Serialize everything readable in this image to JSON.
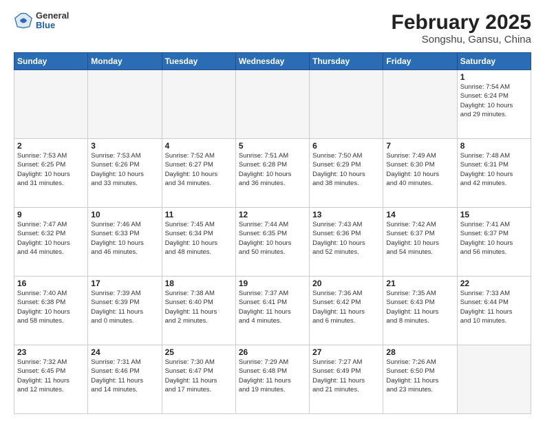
{
  "header": {
    "logo": {
      "general": "General",
      "blue": "Blue"
    },
    "title": "February 2025",
    "subtitle": "Songshu, Gansu, China"
  },
  "weekdays": [
    "Sunday",
    "Monday",
    "Tuesday",
    "Wednesday",
    "Thursday",
    "Friday",
    "Saturday"
  ],
  "weeks": [
    [
      {
        "day": null,
        "info": null
      },
      {
        "day": null,
        "info": null
      },
      {
        "day": null,
        "info": null
      },
      {
        "day": null,
        "info": null
      },
      {
        "day": null,
        "info": null
      },
      {
        "day": null,
        "info": null
      },
      {
        "day": "1",
        "info": "Sunrise: 7:54 AM\nSunset: 6:24 PM\nDaylight: 10 hours\nand 29 minutes."
      }
    ],
    [
      {
        "day": "2",
        "info": "Sunrise: 7:53 AM\nSunset: 6:25 PM\nDaylight: 10 hours\nand 31 minutes."
      },
      {
        "day": "3",
        "info": "Sunrise: 7:53 AM\nSunset: 6:26 PM\nDaylight: 10 hours\nand 33 minutes."
      },
      {
        "day": "4",
        "info": "Sunrise: 7:52 AM\nSunset: 6:27 PM\nDaylight: 10 hours\nand 34 minutes."
      },
      {
        "day": "5",
        "info": "Sunrise: 7:51 AM\nSunset: 6:28 PM\nDaylight: 10 hours\nand 36 minutes."
      },
      {
        "day": "6",
        "info": "Sunrise: 7:50 AM\nSunset: 6:29 PM\nDaylight: 10 hours\nand 38 minutes."
      },
      {
        "day": "7",
        "info": "Sunrise: 7:49 AM\nSunset: 6:30 PM\nDaylight: 10 hours\nand 40 minutes."
      },
      {
        "day": "8",
        "info": "Sunrise: 7:48 AM\nSunset: 6:31 PM\nDaylight: 10 hours\nand 42 minutes."
      }
    ],
    [
      {
        "day": "9",
        "info": "Sunrise: 7:47 AM\nSunset: 6:32 PM\nDaylight: 10 hours\nand 44 minutes."
      },
      {
        "day": "10",
        "info": "Sunrise: 7:46 AM\nSunset: 6:33 PM\nDaylight: 10 hours\nand 46 minutes."
      },
      {
        "day": "11",
        "info": "Sunrise: 7:45 AM\nSunset: 6:34 PM\nDaylight: 10 hours\nand 48 minutes."
      },
      {
        "day": "12",
        "info": "Sunrise: 7:44 AM\nSunset: 6:35 PM\nDaylight: 10 hours\nand 50 minutes."
      },
      {
        "day": "13",
        "info": "Sunrise: 7:43 AM\nSunset: 6:36 PM\nDaylight: 10 hours\nand 52 minutes."
      },
      {
        "day": "14",
        "info": "Sunrise: 7:42 AM\nSunset: 6:37 PM\nDaylight: 10 hours\nand 54 minutes."
      },
      {
        "day": "15",
        "info": "Sunrise: 7:41 AM\nSunset: 6:37 PM\nDaylight: 10 hours\nand 56 minutes."
      }
    ],
    [
      {
        "day": "16",
        "info": "Sunrise: 7:40 AM\nSunset: 6:38 PM\nDaylight: 10 hours\nand 58 minutes."
      },
      {
        "day": "17",
        "info": "Sunrise: 7:39 AM\nSunset: 6:39 PM\nDaylight: 11 hours\nand 0 minutes."
      },
      {
        "day": "18",
        "info": "Sunrise: 7:38 AM\nSunset: 6:40 PM\nDaylight: 11 hours\nand 2 minutes."
      },
      {
        "day": "19",
        "info": "Sunrise: 7:37 AM\nSunset: 6:41 PM\nDaylight: 11 hours\nand 4 minutes."
      },
      {
        "day": "20",
        "info": "Sunrise: 7:36 AM\nSunset: 6:42 PM\nDaylight: 11 hours\nand 6 minutes."
      },
      {
        "day": "21",
        "info": "Sunrise: 7:35 AM\nSunset: 6:43 PM\nDaylight: 11 hours\nand 8 minutes."
      },
      {
        "day": "22",
        "info": "Sunrise: 7:33 AM\nSunset: 6:44 PM\nDaylight: 11 hours\nand 10 minutes."
      }
    ],
    [
      {
        "day": "23",
        "info": "Sunrise: 7:32 AM\nSunset: 6:45 PM\nDaylight: 11 hours\nand 12 minutes."
      },
      {
        "day": "24",
        "info": "Sunrise: 7:31 AM\nSunset: 6:46 PM\nDaylight: 11 hours\nand 14 minutes."
      },
      {
        "day": "25",
        "info": "Sunrise: 7:30 AM\nSunset: 6:47 PM\nDaylight: 11 hours\nand 17 minutes."
      },
      {
        "day": "26",
        "info": "Sunrise: 7:29 AM\nSunset: 6:48 PM\nDaylight: 11 hours\nand 19 minutes."
      },
      {
        "day": "27",
        "info": "Sunrise: 7:27 AM\nSunset: 6:49 PM\nDaylight: 11 hours\nand 21 minutes."
      },
      {
        "day": "28",
        "info": "Sunrise: 7:26 AM\nSunset: 6:50 PM\nDaylight: 11 hours\nand 23 minutes."
      },
      {
        "day": null,
        "info": null
      }
    ]
  ]
}
